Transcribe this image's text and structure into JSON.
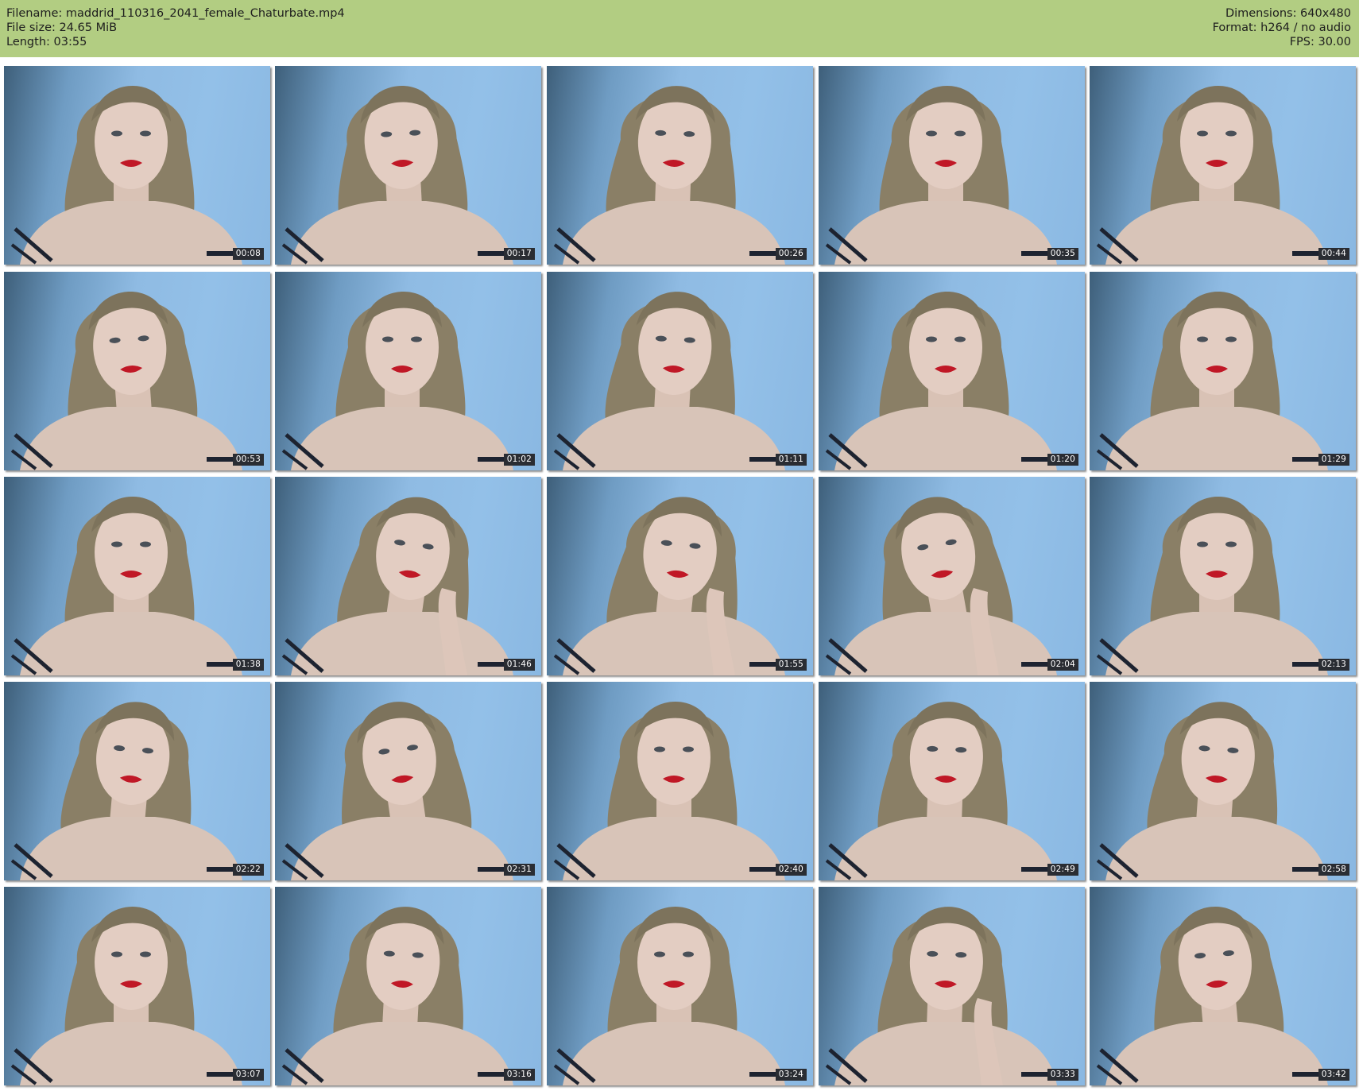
{
  "header": {
    "background": "#b2cd82",
    "filename": "Filename: maddrid_110316_2041_female_Chaturbate.mp4",
    "file_size": "File size: 24.65 MiB",
    "length": "Length: 03:55",
    "dimensions": "Dimensions: 640x480",
    "format": "Format: h264 / no audio",
    "fps": "FPS: 30.00"
  },
  "thumbnails": [
    {
      "timestamp": "00:08"
    },
    {
      "timestamp": "00:17"
    },
    {
      "timestamp": "00:26"
    },
    {
      "timestamp": "00:35"
    },
    {
      "timestamp": "00:44"
    },
    {
      "timestamp": "00:53"
    },
    {
      "timestamp": "01:02"
    },
    {
      "timestamp": "01:11"
    },
    {
      "timestamp": "01:20"
    },
    {
      "timestamp": "01:29"
    },
    {
      "timestamp": "01:38"
    },
    {
      "timestamp": "01:46"
    },
    {
      "timestamp": "01:55"
    },
    {
      "timestamp": "02:04"
    },
    {
      "timestamp": "02:13"
    },
    {
      "timestamp": "02:22"
    },
    {
      "timestamp": "02:31"
    },
    {
      "timestamp": "02:40"
    },
    {
      "timestamp": "02:49"
    },
    {
      "timestamp": "02:58"
    },
    {
      "timestamp": "03:07"
    },
    {
      "timestamp": "03:16"
    },
    {
      "timestamp": "03:24"
    },
    {
      "timestamp": "03:33"
    },
    {
      "timestamp": "03:42"
    }
  ]
}
